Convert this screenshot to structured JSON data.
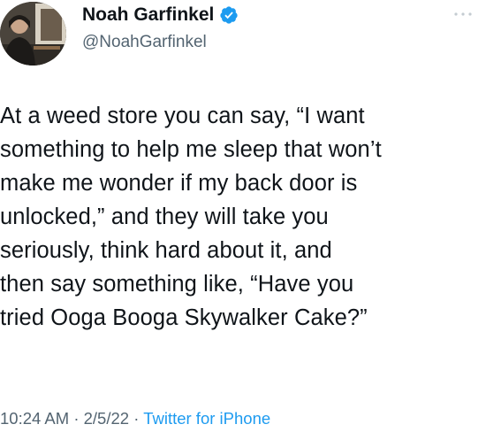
{
  "author": {
    "name": "Noah Garfinkel",
    "handle": "@NoahGarfinkel",
    "verified": true,
    "avatar_icon": "profile-photo"
  },
  "tweet": {
    "lines": [
      "At a weed store you can say, “I want",
      "something to help me sleep that won’t",
      "make me wonder if my back door is",
      "unlocked,” and they will take you",
      "seriously, think hard about it, and",
      "then say something like, “Have you",
      "tried Ooga Booga Skywalker Cake?”"
    ]
  },
  "meta": {
    "time": "10:24 AM",
    "separator": "·",
    "date": "2/5/22",
    "source": "Twitter for iPhone"
  },
  "colors": {
    "text": "#0f1419",
    "secondary": "#536471",
    "accent": "#1d9bf0"
  }
}
